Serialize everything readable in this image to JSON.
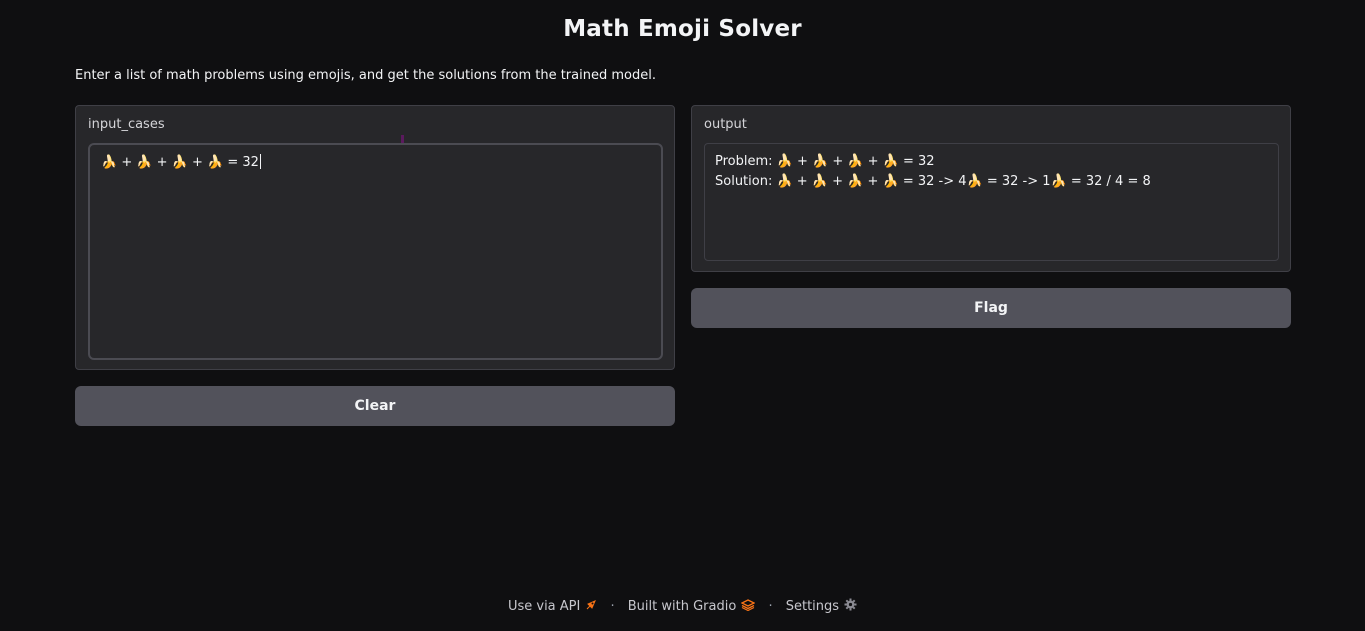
{
  "app": {
    "title": "Math Emoji Solver",
    "description": "Enter a list of math problems using emojis, and get the solutions from the trained model."
  },
  "input": {
    "label": "input_cases",
    "value": "🍌 + 🍌 + 🍌 + 🍌 = 32"
  },
  "output": {
    "label": "output",
    "lines": [
      "Problem: 🍌 + 🍌 + 🍌 + 🍌 = 32",
      "Solution: 🍌 + 🍌 + 🍌 + 🍌 = 32 -> 4🍌 = 32 -> 1🍌 = 32 / 4 = 8"
    ]
  },
  "buttons": {
    "clear": "Clear",
    "flag": "Flag"
  },
  "footer": {
    "api": "Use via API",
    "built": "Built with Gradio",
    "settings": "Settings",
    "separator": "·",
    "icons": [
      "rocket-icon",
      "gradio-logo-icon",
      "gear-icon"
    ]
  },
  "colors": {
    "background": "#0f0f11",
    "panel": "#27272a",
    "button": "#52525b",
    "accent": "#f97316"
  }
}
